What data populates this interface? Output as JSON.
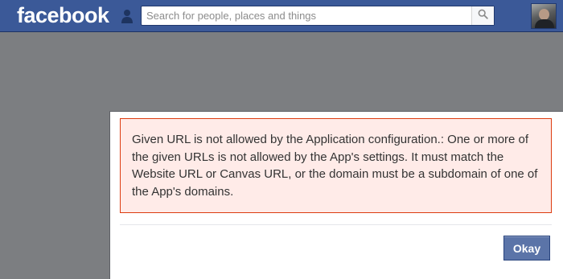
{
  "header": {
    "logo_text": "facebook",
    "search": {
      "placeholder": "Search for people, places and things",
      "value": ""
    },
    "icons": {
      "friend_requests": "person-icon",
      "search": "search-icon",
      "profile": "avatar"
    }
  },
  "dialog": {
    "error_message": "Given URL is not allowed by the Application configuration.: One or more of the given URLs is not allowed by the App's settings. It must match the Website URL or Canvas URL, or the domain must be a subdomain of one of the App's domains.",
    "okay_label": "Okay"
  },
  "colors": {
    "brand_blue": "#3b5998",
    "error_background": "#ffebe8",
    "error_border": "#dd3c10",
    "button_blue": "#5b74a8"
  }
}
